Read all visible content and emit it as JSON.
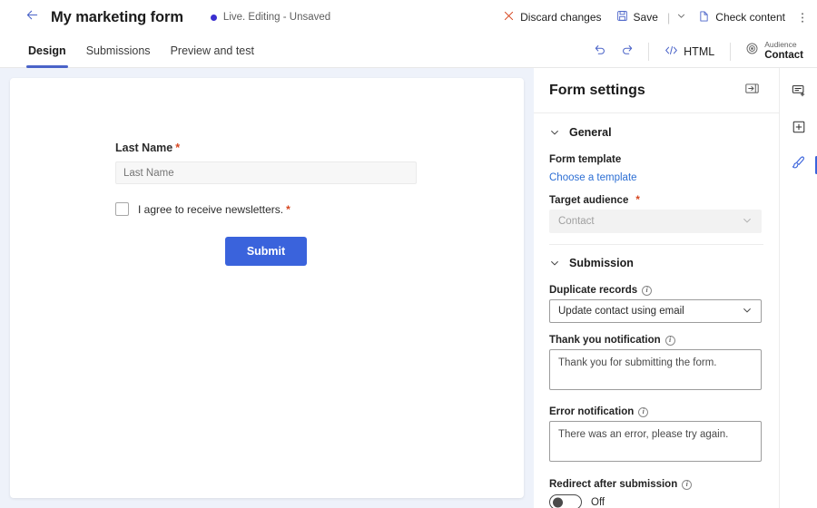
{
  "topbar": {
    "back_icon": "arrow-left-icon",
    "title": "My marketing form",
    "status": "Live. Editing - Unsaved",
    "discard_label": "Discard changes",
    "discard_icon": "close-x-icon",
    "save_label": "Save",
    "save_icon": "floppy-disk-icon",
    "save_caret_icon": "chevron-down-icon",
    "check_content_label": "Check content",
    "check_content_icon": "document-icon",
    "more_icon": "more-vertical-icon"
  },
  "tabbar": {
    "tabs": [
      {
        "label": "Design",
        "active": true
      },
      {
        "label": "Submissions",
        "active": false
      },
      {
        "label": "Preview and test",
        "active": false
      }
    ],
    "undo_icon": "undo-arrow-icon",
    "redo_icon": "redo-arrow-icon",
    "html_label": "HTML",
    "html_icon": "code-brackets-icon",
    "audience_icon": "target-icon",
    "audience_top": "Audience",
    "audience_bottom": "Contact"
  },
  "form": {
    "last_name_label": "Last Name",
    "last_name_required": "*",
    "last_name_placeholder": "Last Name",
    "last_name_value": "",
    "consent_label": "I agree to receive newsletters.",
    "consent_required": "*",
    "consent_checked": false,
    "submit_label": "Submit"
  },
  "settings": {
    "title": "Form settings",
    "collapse_icon": "panel-collapse-icon",
    "general": {
      "section_label": "General",
      "chevron_icon": "chevron-down-icon",
      "form_template_label": "Form template",
      "choose_template_link": "Choose a template",
      "target_audience_label": "Target audience",
      "target_audience_required": "*",
      "target_audience_value": "Contact",
      "target_audience_caret": "chevron-down-icon"
    },
    "submission": {
      "section_label": "Submission",
      "chevron_icon": "chevron-down-icon",
      "duplicate_records_label": "Duplicate records",
      "duplicate_records_info": "info-icon",
      "duplicate_records_value": "Update contact using email",
      "duplicate_records_caret": "chevron-down-icon",
      "thank_you_label": "Thank you notification",
      "thank_you_info": "info-icon",
      "thank_you_value": "Thank you for submitting the form.",
      "error_label": "Error notification",
      "error_info": "info-icon",
      "error_value": "There was an error, please try again.",
      "redirect_label": "Redirect after submission",
      "redirect_info": "info-icon",
      "redirect_state": "Off"
    }
  },
  "rail": {
    "items": [
      {
        "icon": "add-field-icon",
        "active": false
      },
      {
        "icon": "add-section-icon",
        "active": false
      },
      {
        "icon": "styles-brush-icon",
        "active": true
      }
    ]
  },
  "colors": {
    "accent": "#3a63dc",
    "link": "#2d6fd4",
    "required": "#d6451f",
    "canvas_bg": "#eef2fa",
    "status_dot": "#3b2fd0"
  }
}
